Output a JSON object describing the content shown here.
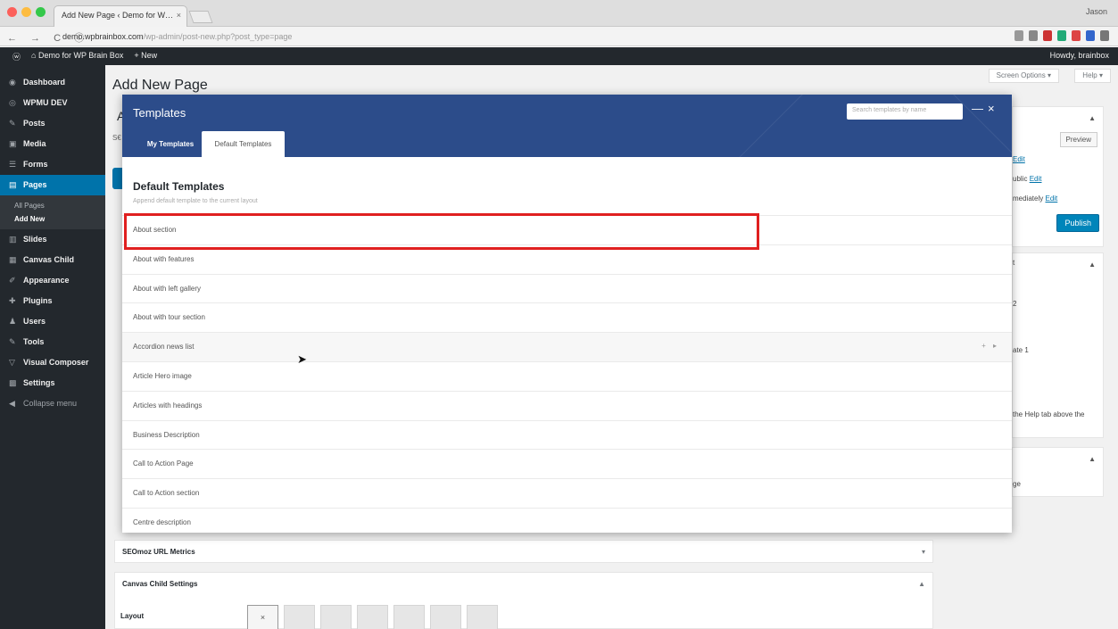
{
  "browser": {
    "tab_title": "Add New Page ‹ Demo for W… ",
    "tab_close": "×",
    "user": "Jason",
    "url_host": "demo.wpbrainbox.com",
    "url_path": "/wp-admin/post-new.php?post_type=page",
    "nav": "←  →  C  ⓘ"
  },
  "adminbar": {
    "wp_logo": "ⓦ",
    "site": "⌂ Demo for WP Brain Box",
    "new": "+ New",
    "howdy": "Howdy, brainbox"
  },
  "sidebar": {
    "items": [
      {
        "icon": "◉",
        "label": "Dashboard"
      },
      {
        "icon": "◎",
        "label": "WPMU DEV"
      },
      {
        "icon": "✎",
        "label": "Posts"
      },
      {
        "icon": "▣",
        "label": "Media"
      },
      {
        "icon": "☰",
        "label": "Forms"
      },
      {
        "icon": "▤",
        "label": "Pages"
      }
    ],
    "sub_items": [
      "All Pages",
      "Add New"
    ],
    "items2": [
      {
        "icon": "▥",
        "label": "Slides"
      },
      {
        "icon": "▦",
        "label": "Canvas Child"
      },
      {
        "icon": "✐",
        "label": "Appearance"
      },
      {
        "icon": "✚",
        "label": "Plugins"
      },
      {
        "icon": "♟",
        "label": "Users"
      },
      {
        "icon": "✎",
        "label": "Tools"
      },
      {
        "icon": "▽",
        "label": "Visual Composer"
      },
      {
        "icon": "▩",
        "label": "Settings"
      }
    ],
    "collapse": {
      "icon": "◀",
      "label": "Collapse menu"
    }
  },
  "main": {
    "page_title": "Add New Page",
    "screen_options": "Screen Options ▾",
    "help": "Help ▾",
    "edge_letter": "A",
    "edge_text": "S€"
  },
  "publish": {
    "preview": "Preview",
    "line1": "Edit",
    "line2_label": "ublic",
    "line2_link": "Edit",
    "line3_label": "mediately",
    "line3_link": "Edit",
    "publish": "Publish",
    "caret": "▲"
  },
  "attributes": {
    "caret": "▲",
    "l1": "t",
    "l2": "2",
    "l3": "ate 1",
    "l4": "the Help tab above the"
  },
  "image_box": {
    "caret": "▲",
    "l1": "ge"
  },
  "seo_box": {
    "title": "SEOmoz URL Metrics",
    "caret": "▾"
  },
  "canvas_box": {
    "title": "Canvas Child Settings",
    "caret": "▲",
    "layout": "Layout",
    "selected": "×"
  },
  "modal": {
    "title": "Templates",
    "search_placeholder": "Search templates by name",
    "minimize": "—",
    "close": "×",
    "tabs": [
      "My Templates",
      "Default Templates"
    ],
    "section_title": "Default Templates",
    "section_subtitle": "Append default template to the current layout",
    "row_actions": "+ ▸",
    "templates": [
      "About section",
      "About with features",
      "About with left gallery",
      "About with tour section",
      "Accordion news list",
      "Article Hero image",
      "Articles with headings",
      "Business Description",
      "Call to Action Page",
      "Call to Action section",
      "Centre description"
    ]
  },
  "colors": {
    "modal_header": "#2c4c8a",
    "admin_dark": "#23282d",
    "active_menu": "#0073aa",
    "highlight": "#e02020"
  }
}
